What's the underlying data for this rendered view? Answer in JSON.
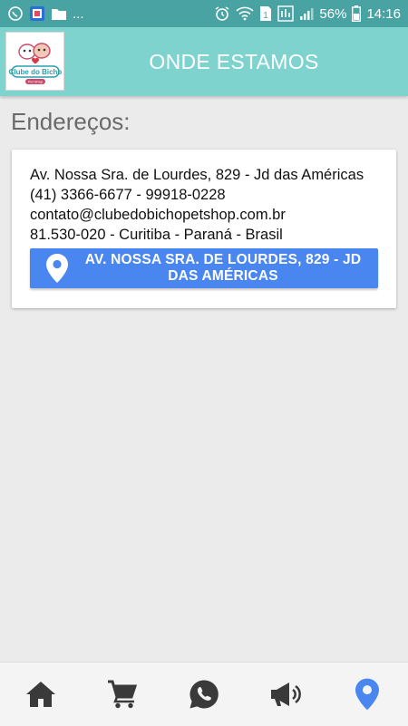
{
  "status_bar": {
    "battery_percent": "56%",
    "time": "14:16",
    "overflow": "...",
    "sim_badge": "1",
    "icon_names": [
      "whatsapp-status-icon",
      "app-notification-icon",
      "folder-icon",
      "alarm-icon",
      "wifi-icon",
      "sim-icon",
      "signal-icon",
      "battery-icon"
    ]
  },
  "header": {
    "title": "ONDE ESTAMOS",
    "logo_text": "Clube do Bicho",
    "logo_subtext": "Pet Shop"
  },
  "section": {
    "title": "Endereços:"
  },
  "address_card": {
    "lines": [
      "Av. Nossa Sra. de Lourdes, 829 - Jd das Américas",
      "(41) 3366-6677 - 99918-0228",
      "contato@clubedobichopetshop.com.br",
      "81.530-020 - Curitiba - Paraná - Brasil"
    ],
    "map_button": {
      "line1": "AV. NOSSA SRA. DE LOURDES, 829 - JD",
      "line2": "DAS AMÉRICAS",
      "icon": "map-pin-icon"
    }
  },
  "bottom_nav": {
    "items": [
      {
        "name": "home",
        "icon": "home-icon",
        "active": false
      },
      {
        "name": "cart",
        "icon": "cart-icon",
        "active": false
      },
      {
        "name": "whatsapp",
        "icon": "whatsapp-icon",
        "active": false
      },
      {
        "name": "promotions",
        "icon": "megaphone-icon",
        "active": false
      },
      {
        "name": "location",
        "icon": "location-pin-icon",
        "active": true
      }
    ]
  },
  "colors": {
    "status_bar": "#4aa3a3",
    "header": "#7fd3cf",
    "button": "#4a86f0",
    "nav_inactive": "#3a3a3a",
    "nav_active": "#4a86f0"
  }
}
